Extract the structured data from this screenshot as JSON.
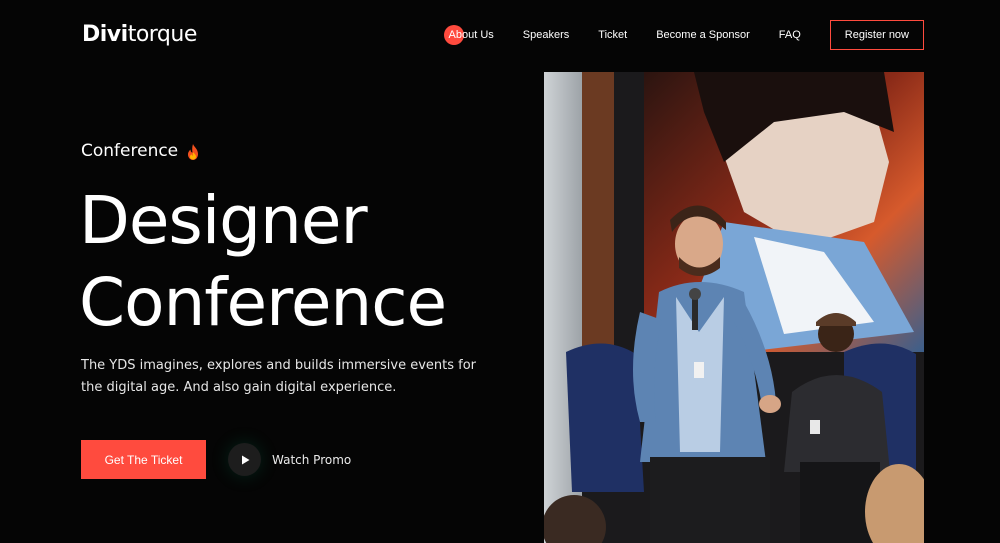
{
  "colors": {
    "accent": "#ff4b3e",
    "background": "#050505"
  },
  "brand": {
    "logo_bold": "Divi",
    "logo_light": "torque"
  },
  "nav": {
    "items": [
      {
        "label": "About Us",
        "active": true
      },
      {
        "label": "Speakers"
      },
      {
        "label": "Ticket"
      },
      {
        "label": "Become a Sponsor"
      },
      {
        "label": "FAQ"
      }
    ],
    "register_label": "Register now"
  },
  "hero": {
    "eyebrow": "Conference",
    "eyebrow_icon": "fire-icon",
    "title_line1": "Designer",
    "title_line2": "Conference",
    "description": "The YDS imagines, explores and builds immersive events for the digital age. And also gain digital experience.",
    "cta_label": "Get The Ticket",
    "promo_label": "Watch Promo",
    "promo_icon": "play-icon"
  }
}
